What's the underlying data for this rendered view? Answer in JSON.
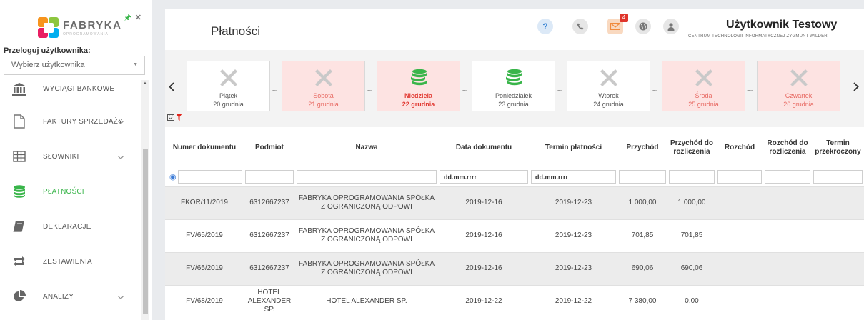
{
  "app": {
    "logo_name": "FABRYKA",
    "logo_sub": "OPROGRAMOWANIA"
  },
  "sidebar": {
    "user_switch_label": "Przeloguj użytkownika:",
    "user_select_placeholder": "Wybierz użytkownika",
    "items": [
      {
        "label": "WYCIĄGI BANKOWE",
        "icon": "bank-icon",
        "has_chevron": false,
        "active": false
      },
      {
        "label": "FAKTURY SPRZEDAŻY",
        "icon": "document-icon",
        "has_chevron": true,
        "active": false
      },
      {
        "label": "SŁOWNIKI",
        "icon": "table-icon",
        "has_chevron": true,
        "active": false
      },
      {
        "label": "PŁATNOŚCI",
        "icon": "coins-icon",
        "has_chevron": false,
        "active": true
      },
      {
        "label": "DEKLARACJE",
        "icon": "book-icon",
        "has_chevron": false,
        "active": false
      },
      {
        "label": "ZESTAWIENIA",
        "icon": "retweet-icon",
        "has_chevron": false,
        "active": false
      },
      {
        "label": "ANALIZY",
        "icon": "pie-chart-icon",
        "has_chevron": true,
        "active": false
      }
    ]
  },
  "header": {
    "page_title": "Płatności",
    "help_glyph": "?",
    "mail_badge": "4",
    "user_name": "Użytkownik Testowy",
    "user_company": "CENTRUM TECHNOLOGII INFORMATYCZNEJ ZYGMUNT WILDER"
  },
  "calendar": {
    "days": [
      {
        "name": "Piątek",
        "date": "20 grudnia",
        "type": "empty",
        "pink": false,
        "today": false
      },
      {
        "name": "Sobota",
        "date": "21 grudnia",
        "type": "empty",
        "pink": true,
        "today": false
      },
      {
        "name": "Niedziela",
        "date": "22 grudnia",
        "type": "payment",
        "pink": true,
        "today": true
      },
      {
        "name": "Poniedziałek",
        "date": "23 grudnia",
        "type": "payment",
        "pink": false,
        "today": false
      },
      {
        "name": "Wtorek",
        "date": "24 grudnia",
        "type": "empty",
        "pink": false,
        "today": false
      },
      {
        "name": "Środa",
        "date": "25 grudnia",
        "type": "empty",
        "pink": true,
        "today": false
      },
      {
        "name": "Czwartek",
        "date": "26 grudnia",
        "type": "empty",
        "pink": true,
        "today": false
      }
    ],
    "dots": "......"
  },
  "table": {
    "headers": [
      "Numer dokumentu",
      "Podmiot",
      "Nazwa",
      "Data dokumentu",
      "Termin płatności",
      "Przychód",
      "Przychód do rozliczenia",
      "Rozchód",
      "Rozchód do rozliczenia",
      "Termin przekroczony"
    ],
    "date_placeholder": "dd.mm.rrrr",
    "rows": [
      {
        "numer": "FKOR/11/2019",
        "podmiot": "6312667237",
        "nazwa": "FABRYKA OPROGRAMOWANIA SPÓŁKA Z OGRANICZONĄ ODPOWI",
        "data": "2019-12-16",
        "termin": "2019-12-23",
        "przychod": "1 000,00",
        "przychod_roz": "1 000,00",
        "rozchod": "",
        "rozchod_roz": "",
        "przekroczony": ""
      },
      {
        "numer": "FV/65/2019",
        "podmiot": "6312667237",
        "nazwa": "FABRYKA OPROGRAMOWANIA SPÓŁKA Z OGRANICZONĄ ODPOWI",
        "data": "2019-12-16",
        "termin": "2019-12-23",
        "przychod": "701,85",
        "przychod_roz": "701,85",
        "rozchod": "",
        "rozchod_roz": "",
        "przekroczony": ""
      },
      {
        "numer": "FV/65/2019",
        "podmiot": "6312667237",
        "nazwa": "FABRYKA OPROGRAMOWANIA SPÓŁKA Z OGRANICZONĄ ODPOWI",
        "data": "2019-12-16",
        "termin": "2019-12-23",
        "przychod": "690,06",
        "przychod_roz": "690,06",
        "rozchod": "",
        "rozchod_roz": "",
        "przekroczony": ""
      },
      {
        "numer": "FV/68/2019",
        "podmiot": "HOTEL ALEXANDER SP.",
        "nazwa": "HOTEL ALEXANDER SP.",
        "data": "2019-12-22",
        "termin": "2019-12-22",
        "przychod": "7 380,00",
        "przychod_roz": "0,00",
        "rozchod": "",
        "rozchod_roz": "",
        "przekroczony": ""
      }
    ]
  },
  "colors": {
    "accent_green": "#39b54a",
    "pink_day": "#fde3e2",
    "today_red": "#e23d36",
    "badge_red": "#e0352b"
  }
}
